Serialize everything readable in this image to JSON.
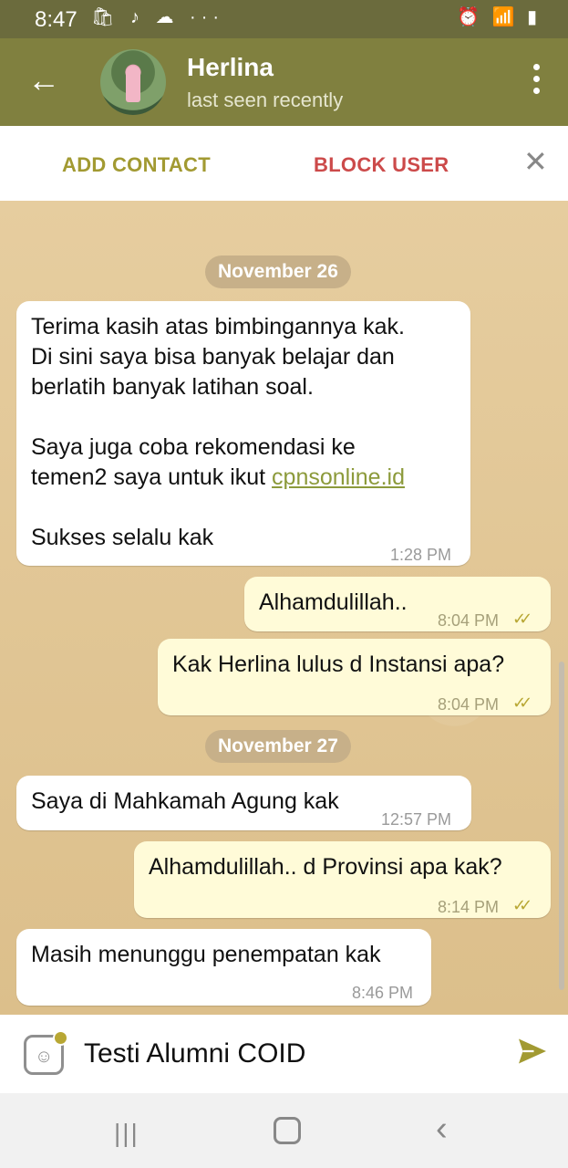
{
  "status_bar": {
    "time": "8:47",
    "left_icons": "🛍 ♪ ☁ ···",
    "right_icons": "⏰ 📶 ▮"
  },
  "header": {
    "name": "Herlina",
    "status": "last seen recently",
    "back_icon": "←"
  },
  "action_bar": {
    "add_contact": "ADD CONTACT",
    "block_user": "BLOCK USER",
    "close": "✕"
  },
  "messages": [
    {
      "date": "November 26"
    },
    {
      "dir": "in",
      "text": "Terima kasih atas bimbingannya kak.\nDi sini saya bisa banyak belajar dan\nberlatih banyak latihan soal.\n\nSaya juga coba rekomendasi ke\ntemen2 saya untuk ikut ",
      "link": "cpnsonline.id",
      "text_after": "\n\nSukses selalu kak",
      "time": "1:28 PM"
    },
    {
      "dir": "out",
      "text": "Alhamdulillah..",
      "time": "8:04 PM",
      "check": "✓✓"
    },
    {
      "dir": "out",
      "text": "Kak Herlina lulus d Instansi apa?",
      "time": "8:04 PM",
      "check": "✓✓"
    },
    {
      "date": "November 27"
    },
    {
      "dir": "in",
      "text": "Saya di Mahkamah Agung kak",
      "time": "12:57 PM"
    },
    {
      "dir": "out",
      "text": "Alhamdulillah.. d Provinsi apa kak?",
      "time": "8:14 PM",
      "check": "✓✓"
    },
    {
      "dir": "in",
      "text": "Masih menunggu penempatan kak",
      "time": "8:46 PM"
    }
  ],
  "input": {
    "value": "Testi Alumni COID"
  },
  "icons": {
    "sticker": "sticker-icon",
    "send": "send-icon",
    "menu": "more-vert-icon"
  },
  "nav": {
    "recent": "|||",
    "back": "‹"
  }
}
